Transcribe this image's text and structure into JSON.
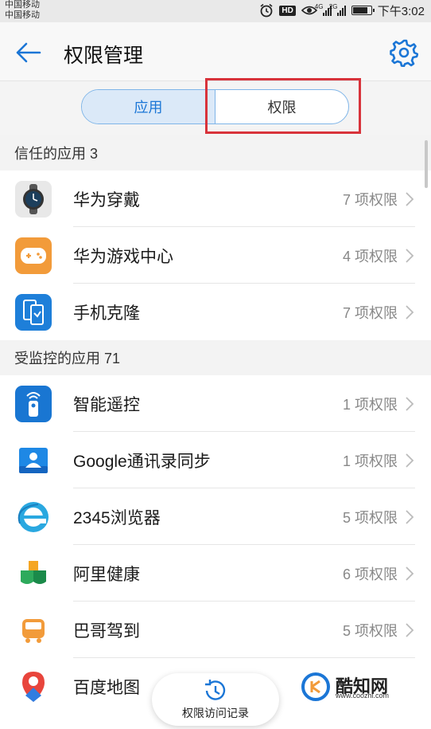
{
  "status": {
    "carrier1": "中国移动",
    "carrier2": "中国移动",
    "hd": "HD",
    "net1": "4G",
    "net2": "2G",
    "time": "下午3:02",
    "battery_level": 0.85
  },
  "header": {
    "title": "权限管理",
    "back_icon": "back-arrow-icon",
    "settings_icon": "gear-icon",
    "accent": "#1b76d6"
  },
  "tabs": {
    "apps_label": "应用",
    "perms_label": "权限"
  },
  "sections": [
    {
      "header": "信任的应用 3",
      "items": [
        {
          "name": "华为穿戴",
          "perm": "7 项权限"
        },
        {
          "name": "华为游戏中心",
          "perm": "4 项权限"
        },
        {
          "name": "手机克隆",
          "perm": "7 项权限"
        }
      ]
    },
    {
      "header": "受监控的应用 71",
      "items": [
        {
          "name": "智能遥控",
          "perm": "1 项权限"
        },
        {
          "name": "Google通讯录同步",
          "perm": "1 项权限"
        },
        {
          "name": "2345浏览器",
          "perm": "5 项权限"
        },
        {
          "name": "阿里健康",
          "perm": "6 项权限"
        },
        {
          "name": "巴哥驾到",
          "perm": "5 项权限"
        },
        {
          "name": "百度地图",
          "perm": ""
        }
      ]
    }
  ],
  "fab": {
    "label": "权限访问记录"
  },
  "watermark": {
    "text": "酷知网",
    "url": "www.coozhi.com"
  }
}
